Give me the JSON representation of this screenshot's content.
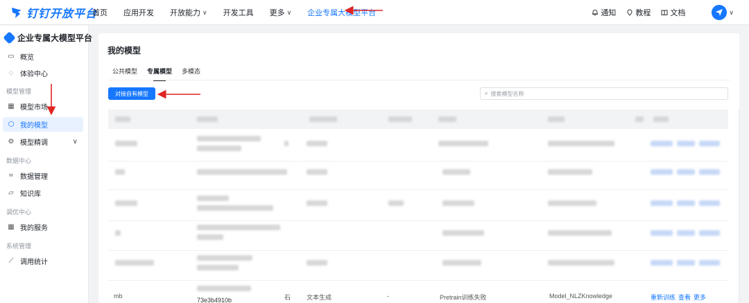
{
  "brand": {
    "name": "钉钉开放平台"
  },
  "nav": {
    "items": [
      {
        "label": "首页",
        "dropdown": false
      },
      {
        "label": "应用开发",
        "dropdown": false
      },
      {
        "label": "开放能力",
        "dropdown": true
      },
      {
        "label": "开发工具",
        "dropdown": false
      },
      {
        "label": "更多",
        "dropdown": true
      },
      {
        "label": "企业专属大模型平台",
        "dropdown": false,
        "active": true
      }
    ]
  },
  "tools": {
    "notify": "通知",
    "tutorial": "教程",
    "docs": "文档"
  },
  "sidebar": {
    "title": "企业专属大模型平台",
    "overview": "概览",
    "experience": "体验中心",
    "group_model": "模型管理",
    "market": "模型市场",
    "my_models": "我的模型",
    "finetune": "模型精调",
    "group_data": "数据中心",
    "data_mgmt": "数据管理",
    "knowledge": "知识库",
    "group_tuning": "调优中心",
    "my_services": "我的服务",
    "group_system": "系统管理",
    "usage_stats": "调用统计"
  },
  "main": {
    "title": "我的模型",
    "tabs": [
      "公共模型",
      "专属模型",
      "多模态"
    ],
    "active_tab": 1,
    "connect_button": "对接自有模型",
    "search_placeholder": "搜索模型名称",
    "last_row": {
      "col_name": "mb",
      "col_id": "73e3b4910b",
      "col_mark": "石",
      "col_type": "文本生成",
      "col_status": "-",
      "col_train": "Pretrain训练失败",
      "col_model": "Model_NLZKnowledge",
      "col_action1": "重新训练",
      "col_action2": "查看",
      "col_action3": "更多"
    }
  },
  "colors": {
    "accent": "#1677ff",
    "annotation": "#e02424"
  }
}
